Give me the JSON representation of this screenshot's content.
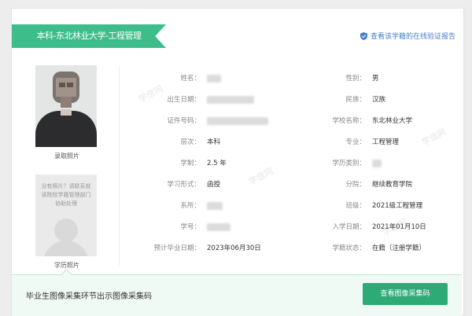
{
  "header": {
    "banner_title": "本科-东北林业大学-工程管理",
    "verify_link": "查看该学籍的在线验证报告",
    "verify_icon": "shield-check-icon"
  },
  "photos": {
    "admission_caption": "录取照片",
    "placeholder_text": "没有照片？请联系就读院校学籍管理部门协助处理",
    "degree_caption": "学历照片"
  },
  "fields": [
    {
      "label": "姓名：",
      "value": "",
      "blurred": true,
      "blur_w": 18
    },
    {
      "label": "性别：",
      "value": "男"
    },
    {
      "label": "出生日期：",
      "value": "",
      "blurred": true,
      "blur_w": 60
    },
    {
      "label": "民族：",
      "value": "汉族"
    },
    {
      "label": "证件号码：",
      "value": "",
      "blurred": true,
      "blur_w": 78
    },
    {
      "label": "学校名称：",
      "value": "东北林业大学"
    },
    {
      "label": "层次：",
      "value": "本科"
    },
    {
      "label": "专业：",
      "value": "工程管理"
    },
    {
      "label": "学制：",
      "value": "2.5 年"
    },
    {
      "label": "学历类别：",
      "value": "",
      "blurred": true,
      "blur_w": 12
    },
    {
      "label": "学习形式：",
      "value": "函授"
    },
    {
      "label": "分院：",
      "value": "继续教育学院"
    },
    {
      "label": "系所：",
      "value": "",
      "blurred": true,
      "blur_w": 20
    },
    {
      "label": "班级：",
      "value": "2021级工程管理"
    },
    {
      "label": "学号：",
      "value": "",
      "blurred": true,
      "blur_w": 30
    },
    {
      "label": "入学日期：",
      "value": "2021年01月10日"
    },
    {
      "label": "预计毕业日期：",
      "value": "2023年06月30日"
    },
    {
      "label": "学籍状态：",
      "value": "在籍（注册学籍）"
    }
  ],
  "footer": {
    "text": "毕业生图像采集环节出示图像采集码",
    "button_label": "查看图像采集码"
  },
  "watermark": "学信网",
  "colors": {
    "banner": "#3dbd8a",
    "button": "#2eaa76",
    "link": "#4a7fc8"
  }
}
